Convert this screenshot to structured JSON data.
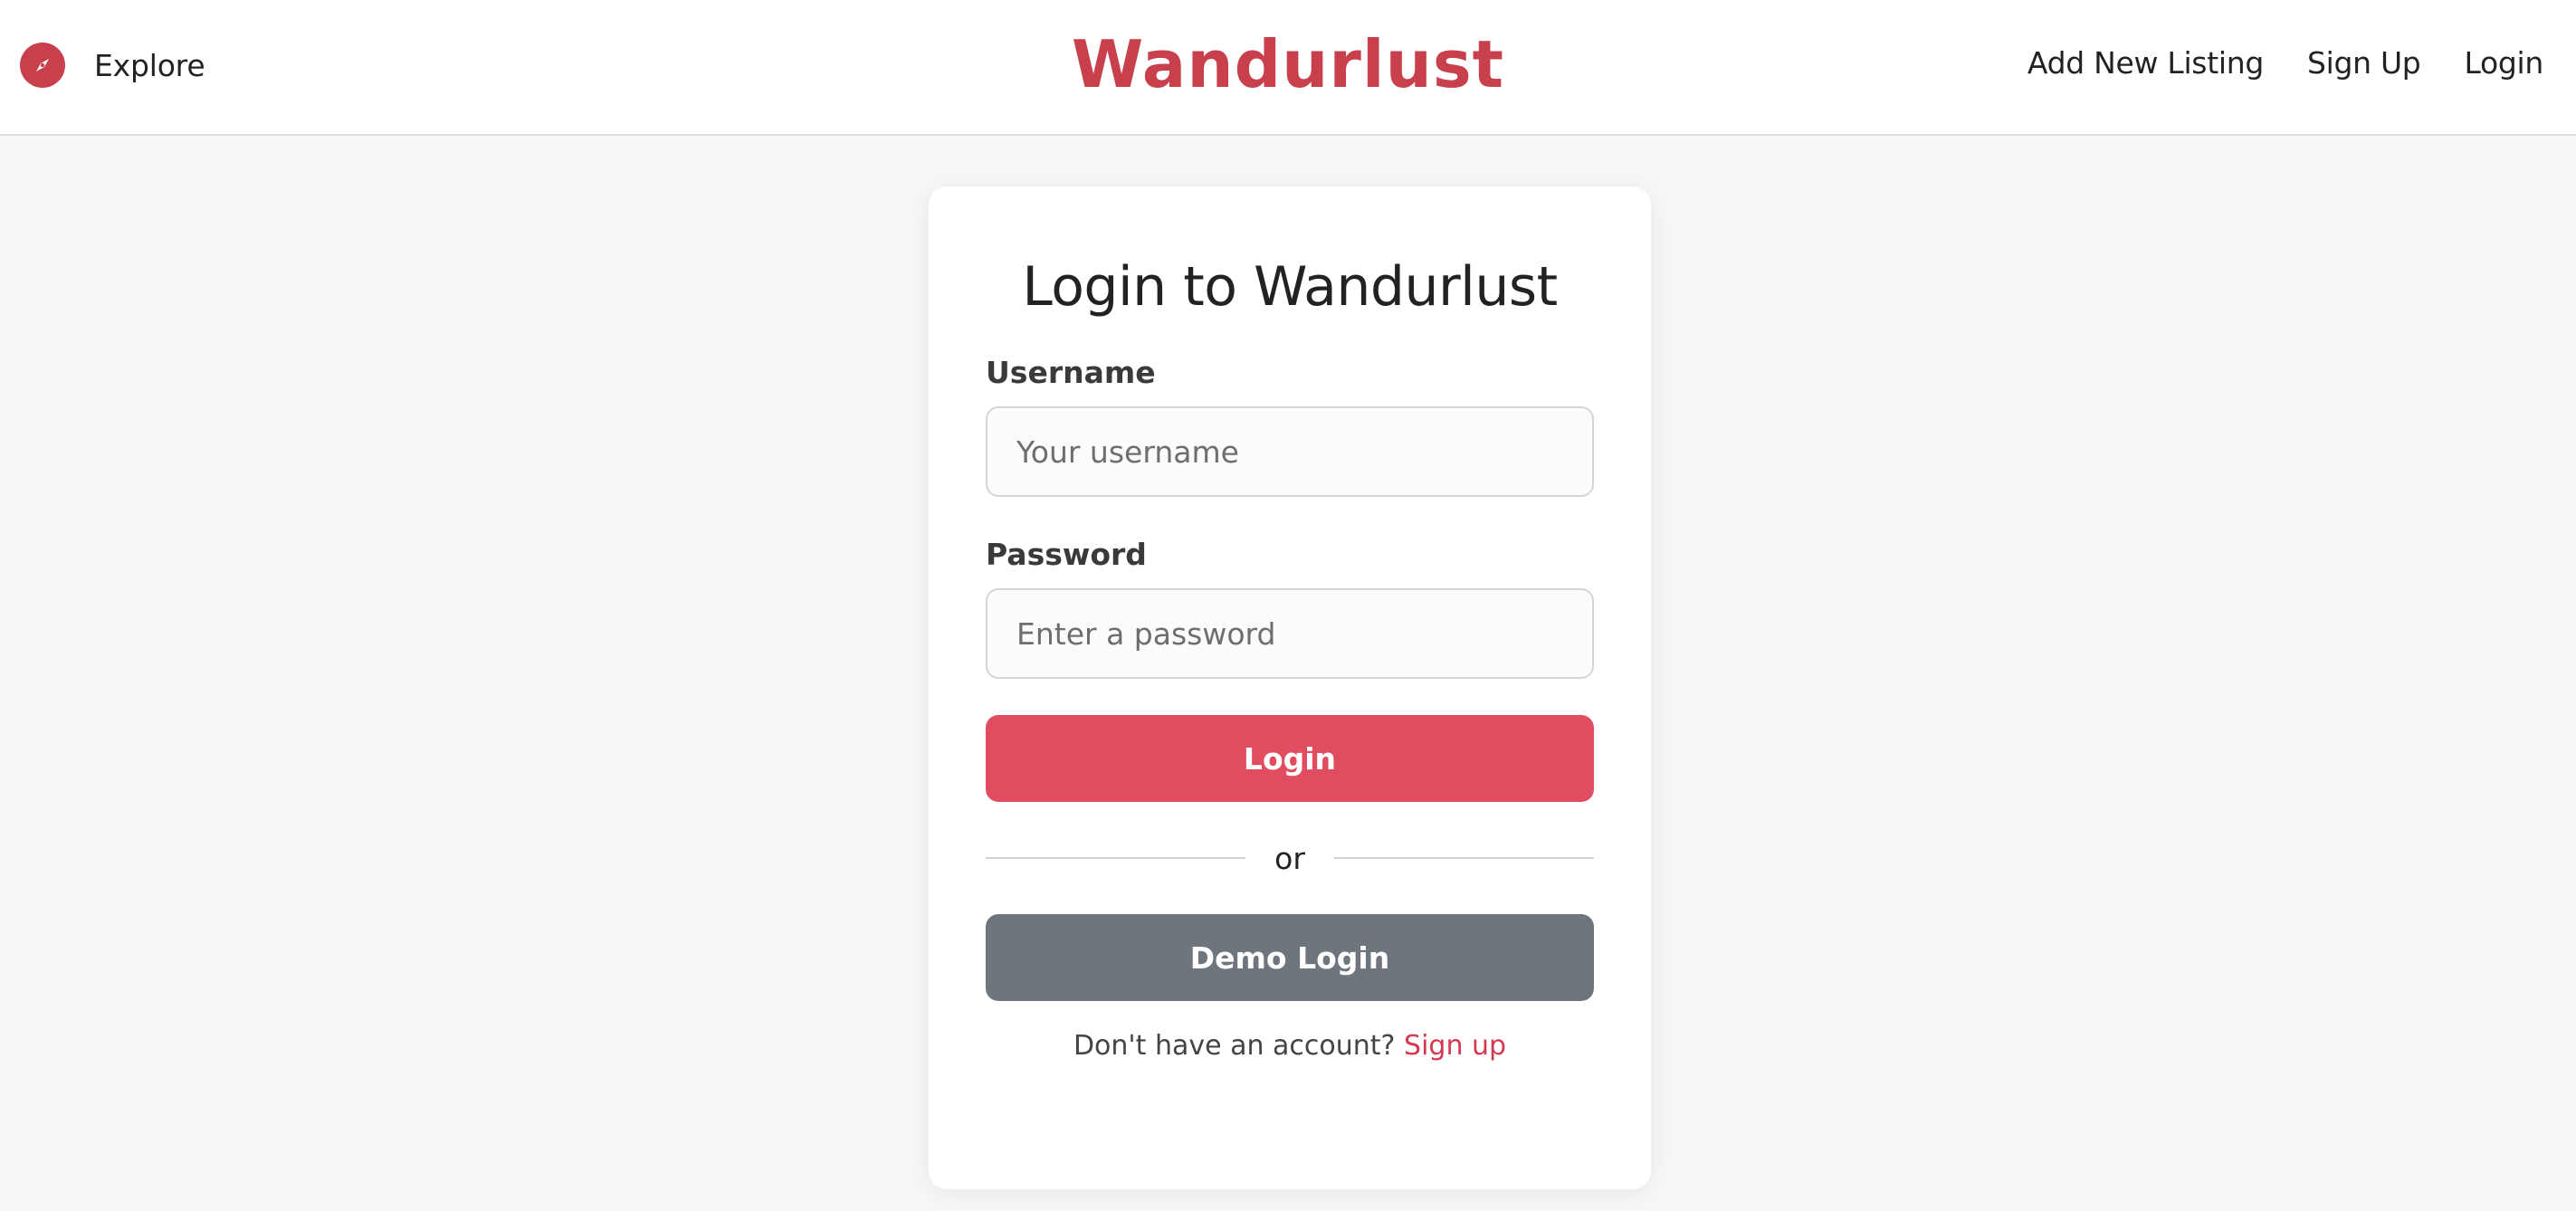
{
  "colors": {
    "brand": "#c8404c",
    "primary_button": "#e04d61",
    "secondary_button": "#6e757c",
    "link": "#d43a4f"
  },
  "navbar": {
    "explore_icon": "compass-icon",
    "explore_label": "Explore",
    "brand": "Wandurlust",
    "links": {
      "add_listing": "Add New Listing",
      "signup": "Sign Up",
      "login": "Login"
    }
  },
  "login_form": {
    "title": "Login to Wandurlust",
    "username": {
      "label": "Username",
      "placeholder": "Your username",
      "value": ""
    },
    "password": {
      "label": "Password",
      "placeholder": "Enter a password",
      "value": ""
    },
    "login_button": "Login",
    "divider_text": "or",
    "demo_button": "Demo Login",
    "signup_prompt": "Don't have an account?",
    "signup_link": "Sign up"
  }
}
